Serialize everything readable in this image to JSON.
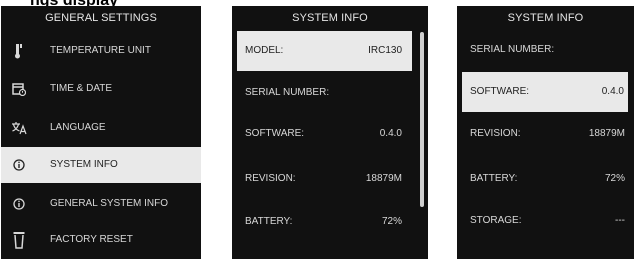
{
  "caption": "ngs display",
  "general_settings": {
    "title": "GENERAL SETTINGS",
    "items": [
      {
        "label": "TEMPERATURE UNIT",
        "icon": "thermometer-icon"
      },
      {
        "label": "TIME & DATE",
        "icon": "calendar-clock-icon"
      },
      {
        "label": "LANGUAGE",
        "icon": "language-icon"
      },
      {
        "label": "SYSTEM INFO",
        "icon": "info-icon",
        "selected": true
      },
      {
        "label": "GENERAL SYSTEM INFO",
        "icon": "info-icon"
      },
      {
        "label": "FACTORY RESET",
        "icon": "trash-icon"
      }
    ]
  },
  "system_info_1": {
    "title": "SYSTEM INFO",
    "rows": [
      {
        "key": "MODEL:",
        "value": "IRC130",
        "selected": true
      },
      {
        "key": "SERIAL NUMBER:",
        "value": ""
      },
      {
        "key": "SOFTWARE:",
        "value": "0.4.0"
      },
      {
        "key": "REVISION:",
        "value": "18879M"
      },
      {
        "key": "BATTERY:",
        "value": "72%"
      }
    ]
  },
  "system_info_2": {
    "title": "SYSTEM INFO",
    "rows": [
      {
        "key": "SERIAL NUMBER:",
        "value": ""
      },
      {
        "key": "SOFTWARE:",
        "value": "0.4.0",
        "selected": true
      },
      {
        "key": "REVISION:",
        "value": "18879M"
      },
      {
        "key": "BATTERY:",
        "value": "72%"
      },
      {
        "key": "STORAGE:",
        "value": "---"
      }
    ]
  },
  "colors": {
    "background": "#111111",
    "text": "#d8d8d8",
    "selected_background": "#e9e9e9",
    "selected_text": "#222222"
  }
}
